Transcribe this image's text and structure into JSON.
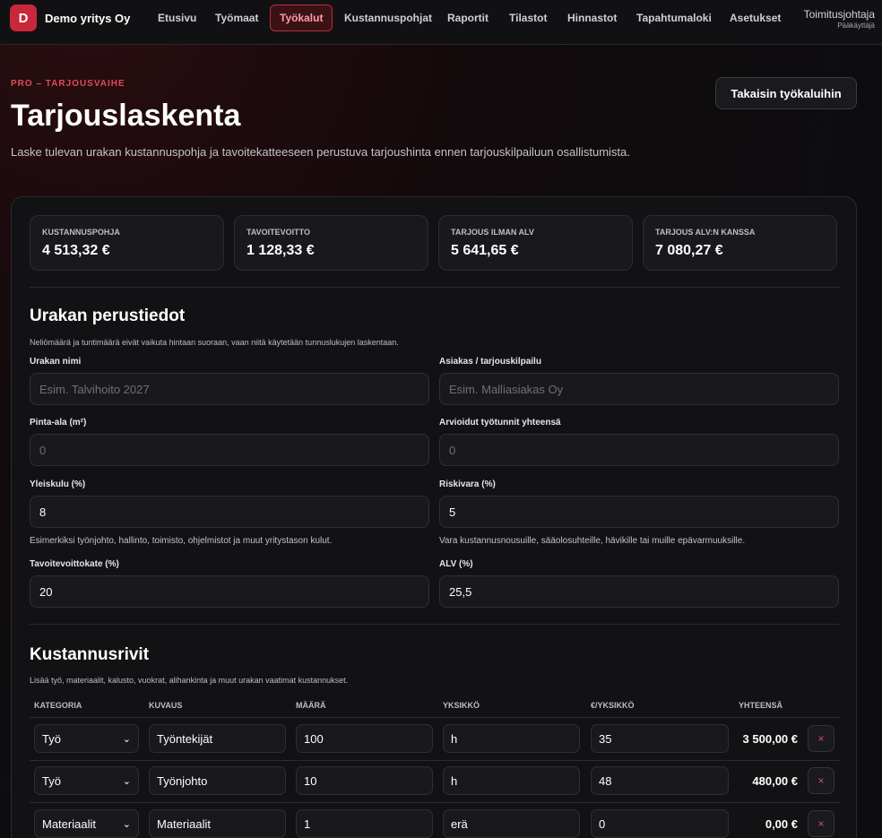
{
  "nav": {
    "logo_letter": "D",
    "brand": "Demo yritys Oy",
    "items": [
      {
        "label": "Etusivu"
      },
      {
        "label": "Työmaat"
      },
      {
        "label": "Työkalut"
      },
      {
        "label": "Kustannuspohjat"
      },
      {
        "label": "Raportit"
      },
      {
        "label": "Tilastot"
      },
      {
        "label": "Hinnastot"
      },
      {
        "label": "Tapahtumaloki"
      },
      {
        "label": "Asetukset"
      }
    ],
    "active_item": "Työkalut",
    "user_name": "Toimitusjohtaja",
    "user_role": "Pääkäyttäjä"
  },
  "header": {
    "eyebrow": "PRO – TARJOUSVAIHE",
    "title": "Tarjouslaskenta",
    "description": "Laske tulevan urakan kustannuspohja ja tavoitekatteeseen perustuva tarjoushinta ennen tarjouskilpailuun osallistumista.",
    "back_button": "Takaisin työkaluihin"
  },
  "stats": [
    {
      "label": "KUSTANNUSPOHJA",
      "value": "4 513,32 €"
    },
    {
      "label": "TAVOITEVOITTO",
      "value": "1 128,33 €"
    },
    {
      "label": "TARJOUS ILMAN ALV",
      "value": "5 641,65 €"
    },
    {
      "label": "TARJOUS ALV:N KANSSA",
      "value": "7 080,27 €"
    }
  ],
  "basics": {
    "title": "Urakan perustiedot",
    "description": "Neliömäärä ja tuntimäärä eivät vaikuta hintaan suoraan, vaan niitä käytetään tunnuslukujen laskentaan.",
    "fields": {
      "name": {
        "label": "Urakan nimi",
        "value": "",
        "placeholder": "Esim. Talvihoito 2027"
      },
      "client": {
        "label": "Asiakas / tarjouskilpailu",
        "value": "",
        "placeholder": "Esim. Malliasiakas Oy"
      },
      "area": {
        "label": "Pinta-ala (m²)",
        "value": "",
        "placeholder": "0"
      },
      "hours": {
        "label": "Arvioidut työtunnit yhteensä",
        "value": "",
        "placeholder": "0"
      },
      "overhead": {
        "label": "Yleiskulu (%)",
        "value": "8",
        "help": "Esimerkiksi työnjohto, hallinto, toimisto, ohjelmistot ja muut yritystason kulut."
      },
      "risk": {
        "label": "Riskivara (%)",
        "value": "5",
        "help": "Vara kustannusnousuille, sääolosuhteille, hävikille tai muille epävarmuuksille."
      },
      "margin": {
        "label": "Tavoitevoittokate (%)",
        "value": "20"
      },
      "vat": {
        "label": "ALV (%)",
        "value": "25,5"
      }
    }
  },
  "costs": {
    "title": "Kustannusrivit",
    "description": "Lisää työ, materiaalit, kalusto, vuokrat, alihankinta ja muut urakan vaatimat kustannukset.",
    "columns": [
      "KATEGORIA",
      "KUVAUS",
      "MÄÄRÄ",
      "YKSIKKÖ",
      "€/YKSIKKÖ",
      "YHTEENSÄ"
    ],
    "rows": [
      {
        "category": "Työ",
        "description": "Työntekijät",
        "quantity": "100",
        "unit": "h",
        "unit_price": "35",
        "total": "3 500,00 €",
        "delete": "×"
      },
      {
        "category": "Työ",
        "description": "Työnjohto",
        "quantity": "10",
        "unit": "h",
        "unit_price": "48",
        "total": "480,00 €",
        "delete": "×"
      },
      {
        "category": "Materiaalit",
        "description": "Materiaalit",
        "quantity": "1",
        "unit": "erä",
        "unit_price": "0",
        "total": "0,00 €",
        "delete": "×"
      }
    ]
  },
  "colors": {
    "accent": "#c8283a",
    "accent_text": "#e04b5a",
    "background": "#0d0d0f",
    "card": "#121214"
  }
}
